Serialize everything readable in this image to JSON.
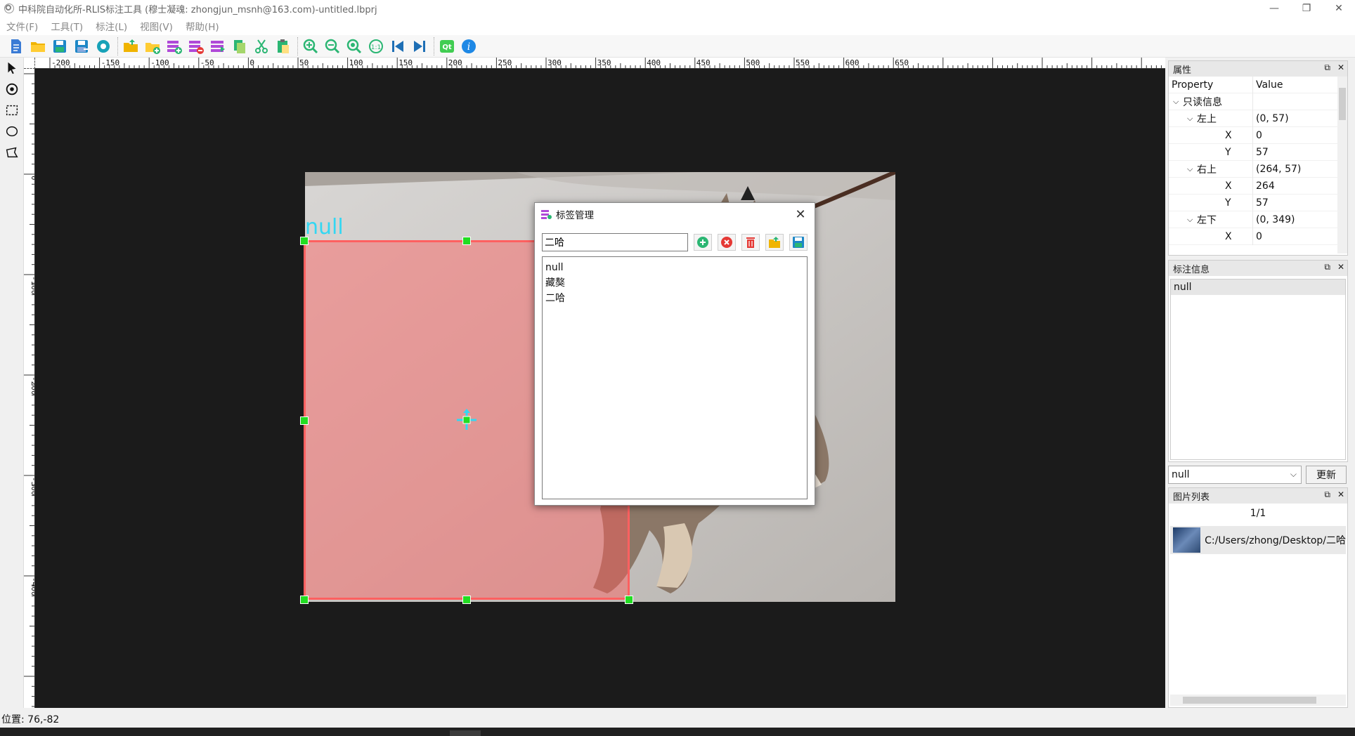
{
  "window": {
    "title": "中科院自动化所-RLIS标注工具 (穆士凝魂: zhongjun_msnh@163.com)-untitled.lbprj",
    "minimize": "—",
    "restore": "❐",
    "close": "✕"
  },
  "menu": [
    "文件(F)",
    "工具(T)",
    "标注(L)",
    "视图(V)",
    "帮助(H)"
  ],
  "toolbar": {
    "icons": [
      "new-file-icon",
      "open-folder-icon",
      "save-icon",
      "save-as-icon",
      "settings-icon",
      "open-image-folder-icon",
      "add-folder-icon",
      "add-label-icon",
      "remove-label-icon",
      "label-list-icon",
      "copy-icon",
      "cut-icon",
      "paste-icon",
      "zoom-in-icon",
      "zoom-out-icon",
      "zoom-fit-icon",
      "zoom-1to1-icon",
      "prev-image-icon",
      "next-image-icon",
      "qt-about-icon",
      "info-icon"
    ]
  },
  "left_tools": [
    "select-arrow-icon",
    "rotate-view-icon",
    "rectangle-tool-icon",
    "ellipse-tool-icon",
    "polygon-tool-icon"
  ],
  "ruler": {
    "top_ticks": [
      "-200",
      "-150",
      "-100",
      "-50",
      "0",
      "50",
      "100",
      "150",
      "200",
      "250",
      "300",
      "350",
      "400",
      "450",
      "500",
      "550",
      "600",
      "650"
    ],
    "left_ticks": [
      "0",
      "-100",
      "-200",
      "-300",
      "-400"
    ]
  },
  "annotation": {
    "label": "null",
    "color": "#ff6060"
  },
  "label_dialog": {
    "title": "标签管理",
    "close": "✕",
    "input_value": "二哈",
    "buttons": [
      "add-circle-icon",
      "remove-circle-icon",
      "delete-trash-icon",
      "import-folder-icon",
      "save-disk-icon"
    ],
    "labels": [
      "null",
      "藏獒",
      "二哈"
    ]
  },
  "properties_panel": {
    "title": "属性",
    "header": {
      "property": "Property",
      "value": "Value"
    },
    "rows": [
      {
        "indent": 0,
        "expander": "v",
        "name": "只读信息",
        "value": ""
      },
      {
        "indent": 1,
        "expander": "v",
        "name": "左上",
        "value": "(0, 57)"
      },
      {
        "indent": 2,
        "expander": "",
        "name": "X",
        "value": "0"
      },
      {
        "indent": 2,
        "expander": "",
        "name": "Y",
        "value": "57"
      },
      {
        "indent": 1,
        "expander": "v",
        "name": "右上",
        "value": "(264, 57)"
      },
      {
        "indent": 2,
        "expander": "",
        "name": "X",
        "value": "264"
      },
      {
        "indent": 2,
        "expander": "",
        "name": "Y",
        "value": "57"
      },
      {
        "indent": 1,
        "expander": "v",
        "name": "左下",
        "value": "(0, 349)"
      },
      {
        "indent": 2,
        "expander": "",
        "name": "X",
        "value": "0"
      }
    ]
  },
  "annotation_panel": {
    "title": "标注信息",
    "items": [
      "null"
    ],
    "combo_value": "null",
    "update_label": "更新"
  },
  "image_panel": {
    "title": "图片列表",
    "count": "1/1",
    "items": [
      "C:/Users/zhong/Desktop/二哈"
    ]
  },
  "status": {
    "position": "位置: 76,-82"
  }
}
